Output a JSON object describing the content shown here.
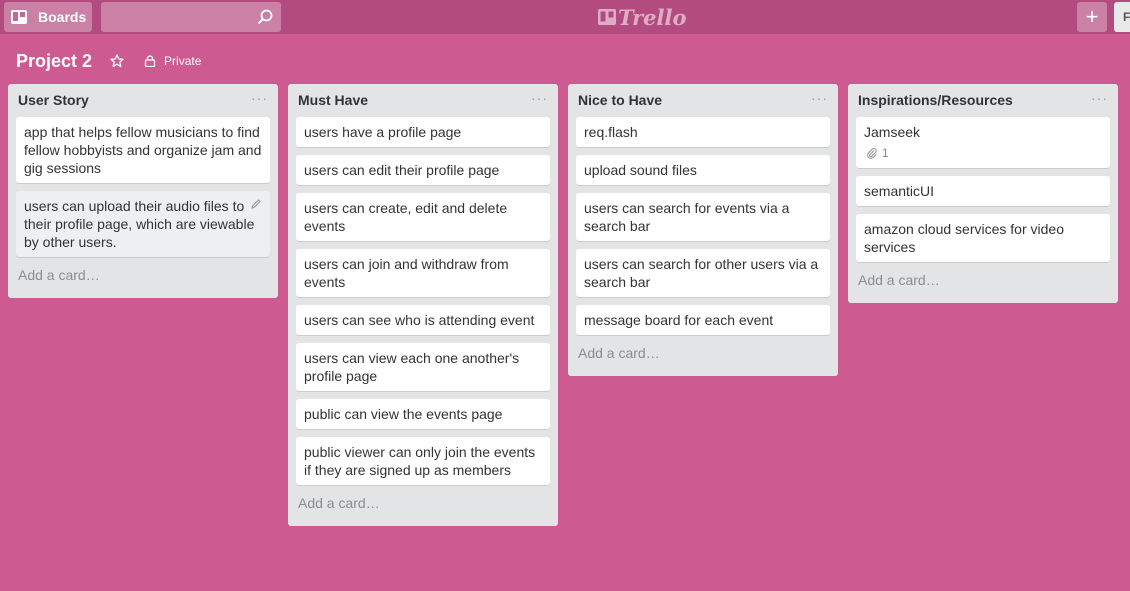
{
  "topbar": {
    "boards_label": "Boards",
    "search_placeholder": "",
    "logo_text": "Trello",
    "add_label": "+",
    "profile_label": "F"
  },
  "board": {
    "title": "Project 2",
    "privacy": "Private"
  },
  "lists": [
    {
      "title": "User Story",
      "menu": "···",
      "cards": [
        "app that helps fellow musicians to find fellow hobbyists and organize jam and gig sessions",
        "users can upload their audio files to their profile page, which are viewable by other users."
      ],
      "add_card": "Add a card…"
    },
    {
      "title": "Must Have",
      "menu": "···",
      "cards": [
        "users have a profile page",
        "users can edit their profile page",
        "users can create, edit and delete events",
        "users can join and withdraw from events",
        "users can see who is attending event",
        "users can view each one another's profile page",
        "public can view the events page",
        "public viewer can only join the events if they are signed up as members"
      ],
      "add_card": "Add a card…"
    },
    {
      "title": "Nice to Have",
      "menu": "···",
      "cards": [
        "req.flash",
        "upload sound files",
        "users can search for events via a search bar",
        "users can search for other users via a search bar",
        "message board for each event"
      ],
      "add_card": "Add a card…"
    },
    {
      "title": "Inspirations/Resources",
      "menu": "···",
      "cards": [
        "Jamseek",
        "semanticUI",
        "amazon cloud services for video services"
      ],
      "card0_attachments": "1",
      "add_card": "Add a card…"
    }
  ],
  "colors": {
    "background": "#cd5a91",
    "topbar": "#b44b7f",
    "list_bg": "#e2e4e6",
    "card_bg": "#ffffff"
  }
}
